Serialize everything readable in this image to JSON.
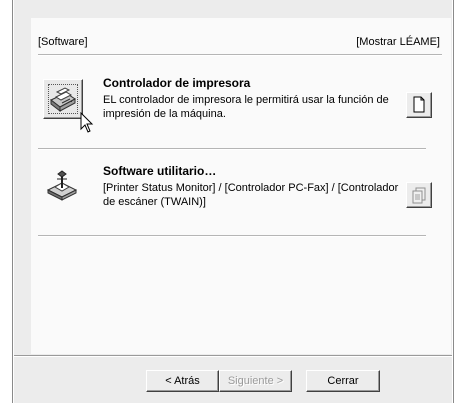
{
  "header": {
    "left_label": "[Software]",
    "right_link": "[Mostrar LÉAME]"
  },
  "items": [
    {
      "title": "Controlador de impresora",
      "description_line1": "EL controlador de impresora le permitirá usar la función de",
      "description_line2": "impresión de la máquina.",
      "icon": "printer-icon"
    },
    {
      "title": "Software utilitario…",
      "description_line1": "[Printer Status Monitor] / [Controlador PC-Fax] / [Controlador",
      "description_line2": "de escáner (TWAIN)]",
      "icon": "utility-software-icon"
    }
  ],
  "buttons": {
    "back": "< Atrás",
    "next": "Siguiente >",
    "close": "Cerrar"
  }
}
